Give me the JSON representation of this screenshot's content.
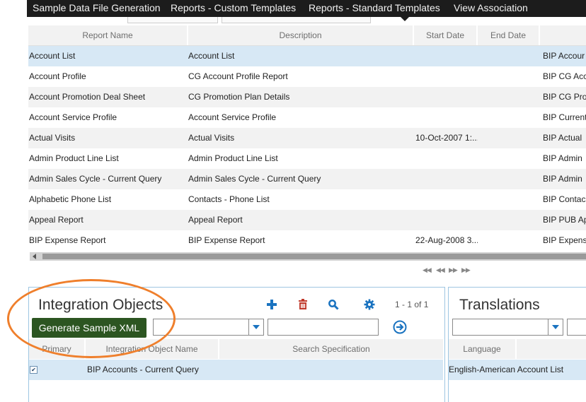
{
  "nav": {
    "tabs": [
      {
        "label": "Sample Data File Generation"
      },
      {
        "label": "Reports - Custom Templates"
      },
      {
        "label": "Reports - Standard Templates"
      },
      {
        "label": "View Association"
      }
    ],
    "active_tab": "Reports - Standard Templates"
  },
  "reports_table": {
    "columns": [
      "Report Name",
      "Description",
      "Start Date",
      "End Date"
    ],
    "rows": [
      {
        "name": "Account List",
        "description": "Account List",
        "start_date": "",
        "end_date": "",
        "extra": "BIP Accour",
        "selected": true
      },
      {
        "name": "Account Profile",
        "description": "CG Account Profile Report",
        "start_date": "",
        "end_date": "",
        "extra": "BIP CG Acc"
      },
      {
        "name": "Account Promotion Deal Sheet",
        "description": "CG Promotion Plan Details",
        "start_date": "",
        "end_date": "",
        "extra": "BIP CG Pro"
      },
      {
        "name": "Account Service Profile",
        "description": "Account Service Profile",
        "start_date": "",
        "end_date": "",
        "extra": "BIP Current"
      },
      {
        "name": "Actual Visits",
        "description": "Actual Visits",
        "start_date": "10-Oct-2007 1:...",
        "end_date": "",
        "extra": "BIP Actual"
      },
      {
        "name": "Admin Product Line List",
        "description": "Admin Product Line List",
        "start_date": "",
        "end_date": "",
        "extra": "BIP Admin"
      },
      {
        "name": "Admin Sales Cycle - Current Query",
        "description": "Admin Sales Cycle - Current Query",
        "start_date": "",
        "end_date": "",
        "extra": "BIP Admin"
      },
      {
        "name": "Alphabetic Phone List",
        "description": "Contacts - Phone List",
        "start_date": "",
        "end_date": "",
        "extra": "BIP Contac"
      },
      {
        "name": "Appeal Report",
        "description": "Appeal Report",
        "start_date": "",
        "end_date": "",
        "extra": "BIP PUB Ap"
      },
      {
        "name": "BIP Expense Report",
        "description": "BIP Expense Report",
        "start_date": "22-Aug-2008 3...",
        "end_date": "",
        "extra": "BIP Expens"
      }
    ]
  },
  "integration": {
    "title": "Integration Objects",
    "count": "1 - 1 of 1",
    "generate_label": "Generate Sample XML",
    "columns": [
      "Primary",
      "Integration Object Name",
      "Search Specification"
    ],
    "rows": [
      {
        "primary": true,
        "name": "BIP Accounts - Current Query",
        "search_spec": ""
      }
    ]
  },
  "translations": {
    "title": "Translations",
    "columns": [
      "Language"
    ],
    "rows": [
      {
        "text": "English-American Account List"
      }
    ]
  },
  "colors": {
    "accent": "#1a73c0",
    "delete": "#c0392b",
    "generate_button": "#2c5521",
    "highlight": "#ef7f2c",
    "selected_row": "#d7e8f5"
  }
}
